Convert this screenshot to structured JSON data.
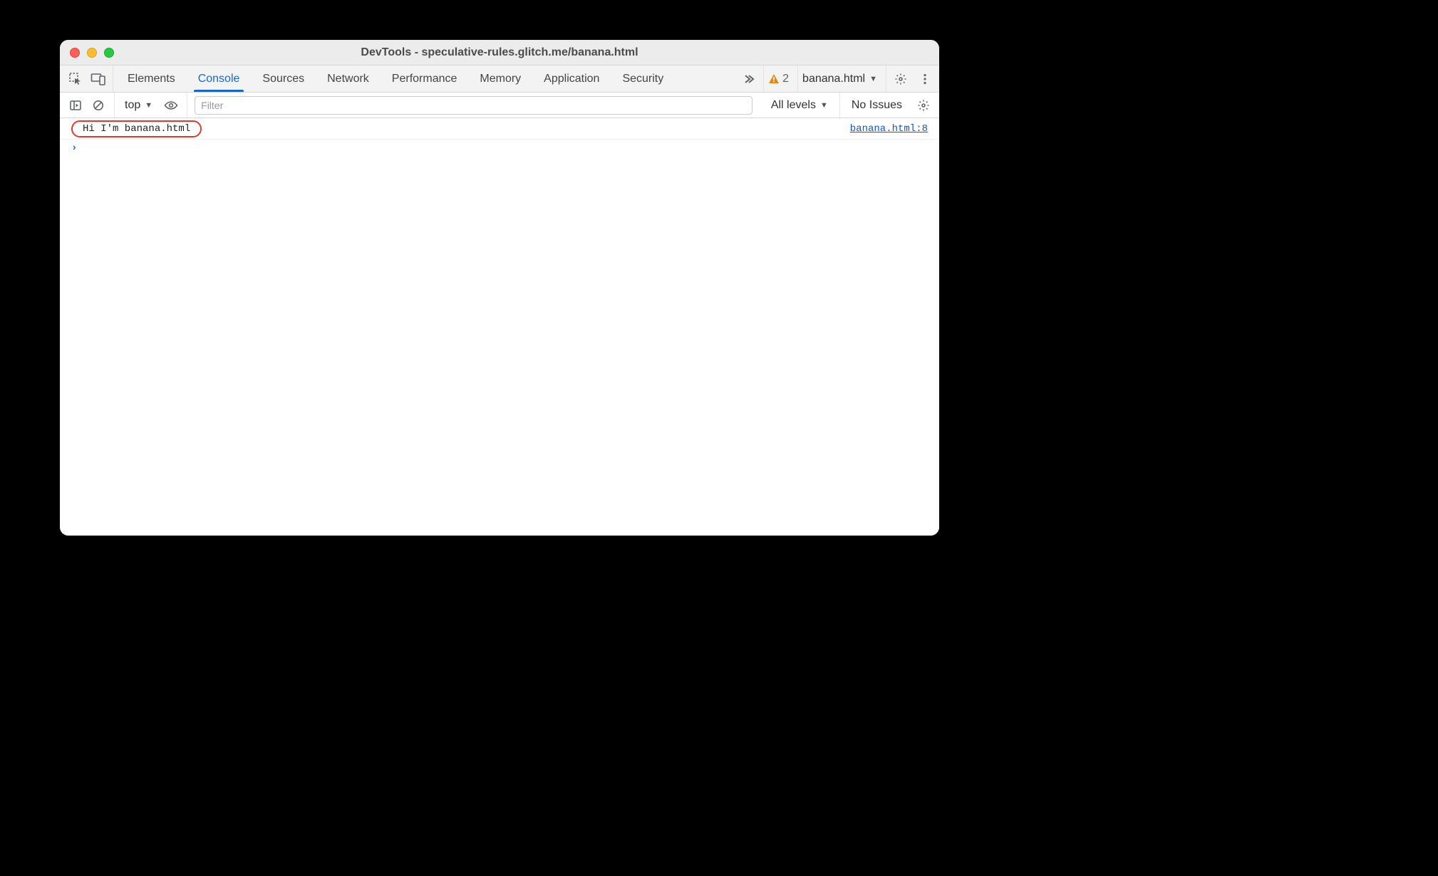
{
  "window": {
    "title": "DevTools - speculative-rules.glitch.me/banana.html"
  },
  "tabs": {
    "items": [
      {
        "label": "Elements"
      },
      {
        "label": "Console"
      },
      {
        "label": "Sources"
      },
      {
        "label": "Network"
      },
      {
        "label": "Performance"
      },
      {
        "label": "Memory"
      },
      {
        "label": "Application"
      },
      {
        "label": "Security"
      }
    ],
    "active_index": 1,
    "warning_count": "2",
    "target_label": "banana.html"
  },
  "console_toolbar": {
    "context_label": "top",
    "filter_placeholder": "Filter",
    "levels_label": "All levels",
    "issues_label": "No Issues"
  },
  "console": {
    "logs": [
      {
        "message": "Hi I'm banana.html",
        "source": "banana.html:8"
      }
    ]
  }
}
